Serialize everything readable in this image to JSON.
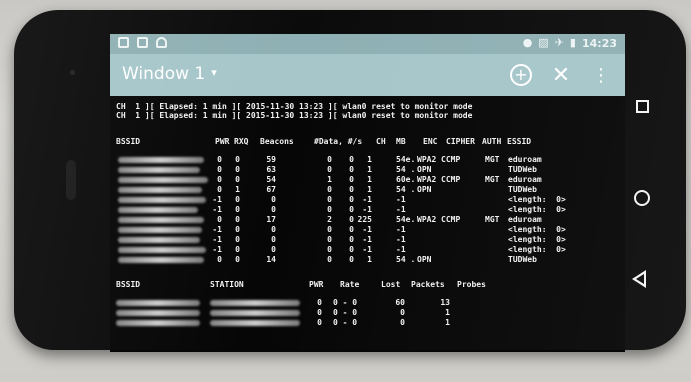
{
  "statusbar": {
    "left_icons": [
      "image-icon",
      "download-icon",
      "android-icon"
    ],
    "right_icons": [
      "circle-icon",
      "no-sim-icon",
      "airplane-icon",
      "battery-icon"
    ],
    "time": "14:23"
  },
  "appbar": {
    "title": "Window 1",
    "caret": "▾",
    "add_glyph": "+",
    "close_glyph": "✕",
    "menu_glyph": "⋮"
  },
  "terminal": {
    "status_lines": [
      "CH  1 ][ Elapsed: 1 min ][ 2015-11-30 13:23 ][ wlan0 reset to monitor mode",
      "CH  1 ][ Elapsed: 1 min ][ 2015-11-30 13:23 ][ wlan0 reset to monitor mode"
    ],
    "ap_headers": {
      "bssid": "BSSID",
      "pwr": "PWR",
      "rxq": "RXQ",
      "beacons": "Beacons",
      "data": "#Data, #/s",
      "ch": "CH",
      "mb": "MB",
      "enc": "ENC",
      "cipher": "CIPHER",
      "auth": "AUTH",
      "essid": "ESSID"
    },
    "ap_rows": [
      {
        "pwr": "0",
        "rxq": "0",
        "beacons": "59",
        "data": "0",
        "rate": "0",
        "ch": "1",
        "mb": "54e.",
        "enc": "WPA2",
        "cipher": "CCMP",
        "auth": "MGT",
        "essid": "eduroam"
      },
      {
        "pwr": "0",
        "rxq": "0",
        "beacons": "63",
        "data": "0",
        "rate": "0",
        "ch": "1",
        "mb": "54 .",
        "enc": "OPN",
        "cipher": "",
        "auth": "",
        "essid": "TUDWeb"
      },
      {
        "pwr": "0",
        "rxq": "0",
        "beacons": "54",
        "data": "1",
        "rate": "0",
        "ch": "1",
        "mb": "60e.",
        "enc": "WPA2",
        "cipher": "CCMP",
        "auth": "MGT",
        "essid": "eduroam"
      },
      {
        "pwr": "0",
        "rxq": "1",
        "beacons": "67",
        "data": "0",
        "rate": "0",
        "ch": "1",
        "mb": "54 .",
        "enc": "OPN",
        "cipher": "",
        "auth": "",
        "essid": "TUDWeb"
      },
      {
        "pwr": "-1",
        "rxq": "0",
        "beacons": "0",
        "data": "0",
        "rate": "0",
        "ch": "-1",
        "mb": "-1",
        "enc": "",
        "cipher": "",
        "auth": "",
        "essid": "<length:  0>"
      },
      {
        "pwr": "-1",
        "rxq": "0",
        "beacons": "0",
        "data": "0",
        "rate": "0",
        "ch": "-1",
        "mb": "-1",
        "enc": "",
        "cipher": "",
        "auth": "",
        "essid": "<length:  0>"
      },
      {
        "pwr": "0",
        "rxq": "0",
        "beacons": "17",
        "data": "2",
        "rate": "0",
        "ch": "225",
        "mb": "54e.",
        "enc": "WPA2",
        "cipher": "CCMP",
        "auth": "MGT",
        "essid": "eduroam"
      },
      {
        "pwr": "-1",
        "rxq": "0",
        "beacons": "0",
        "data": "0",
        "rate": "0",
        "ch": "-1",
        "mb": "-1",
        "enc": "",
        "cipher": "",
        "auth": "",
        "essid": "<length:  0>"
      },
      {
        "pwr": "-1",
        "rxq": "0",
        "beacons": "0",
        "data": "0",
        "rate": "0",
        "ch": "-1",
        "mb": "-1",
        "enc": "",
        "cipher": "",
        "auth": "",
        "essid": "<length:  0>"
      },
      {
        "pwr": "-1",
        "rxq": "0",
        "beacons": "0",
        "data": "0",
        "rate": "0",
        "ch": "-1",
        "mb": "-1",
        "enc": "",
        "cipher": "",
        "auth": "",
        "essid": "<length:  0>"
      },
      {
        "pwr": "0",
        "rxq": "0",
        "beacons": "14",
        "data": "0",
        "rate": "0",
        "ch": "1",
        "mb": "54 .",
        "enc": "OPN",
        "cipher": "",
        "auth": "",
        "essid": "TUDWeb"
      }
    ],
    "station_headers": {
      "bssid": "BSSID",
      "station": "STATION",
      "pwr": "PWR",
      "rate": "Rate",
      "lost": "Lost",
      "packets": "Packets",
      "probes": "Probes"
    },
    "station_rows": [
      {
        "pwr": "0",
        "rate": "0 - 0",
        "lost": "60",
        "packets": "13"
      },
      {
        "pwr": "0",
        "rate": "0 - 0",
        "lost": "0",
        "packets": "1"
      },
      {
        "pwr": "0",
        "rate": "0 - 0",
        "lost": "0",
        "packets": "1"
      }
    ]
  },
  "colors": {
    "appbar": "#a6c6ca",
    "statusbar": "#8fb0b4",
    "terminal_bg": "#060606",
    "terminal_text": "#f2f2f2"
  }
}
